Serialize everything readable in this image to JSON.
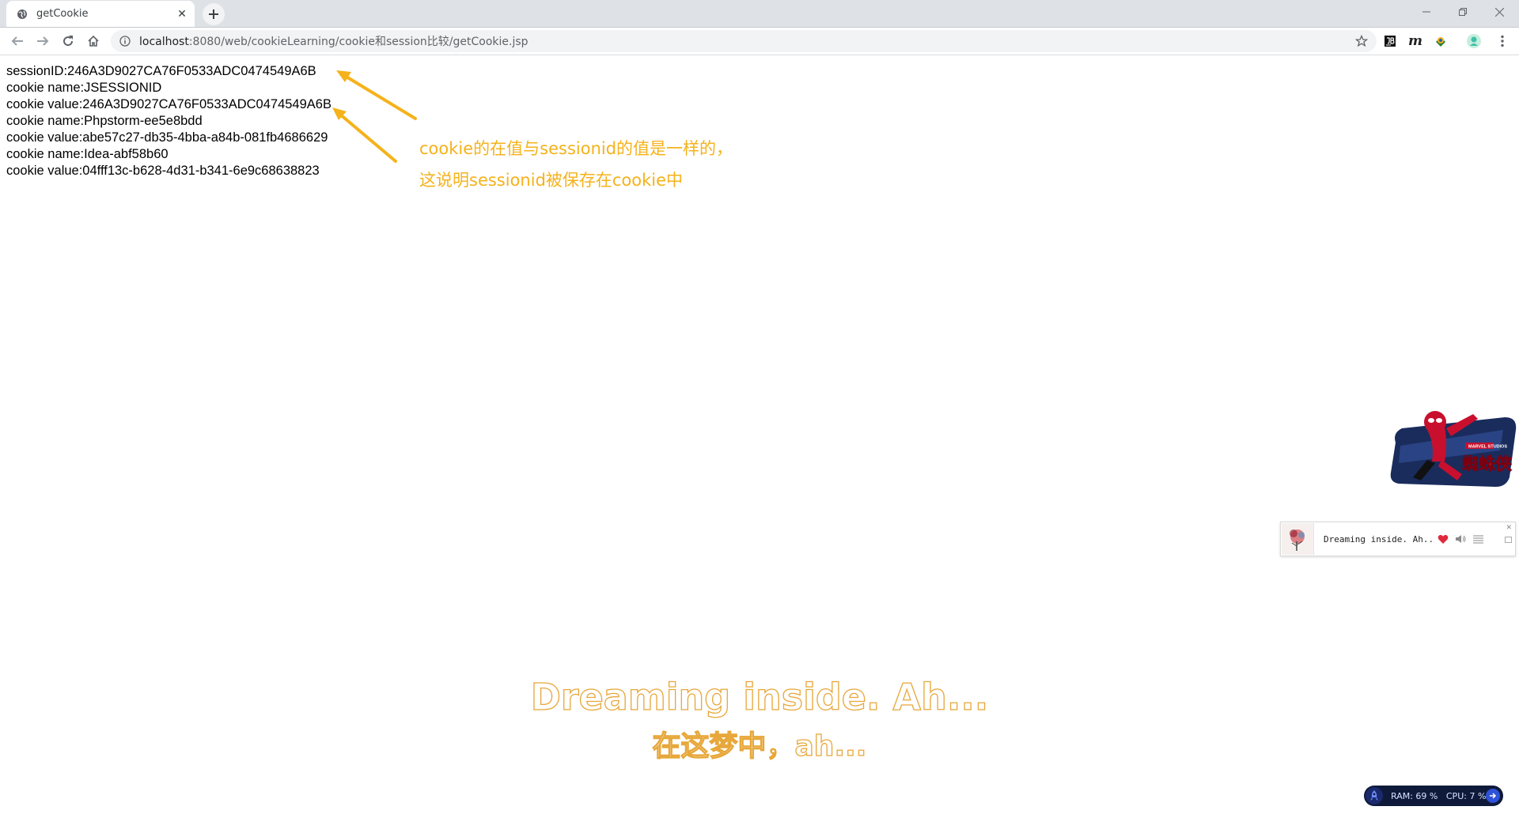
{
  "browser": {
    "tab": {
      "title": "getCookie"
    },
    "address": {
      "host": "localhost",
      "rest": ":8080/web/cookieLearning/cookie和session比较/getCookie.jsp"
    },
    "icons": [
      "globe-icon",
      "close-icon",
      "plus-icon",
      "minimize-icon",
      "restore-icon",
      "close-window-icon",
      "back-icon",
      "forward-icon",
      "reload-icon",
      "home-icon",
      "info-icon",
      "star-icon",
      "jb-extension-icon",
      "m-extension-icon",
      "extension-icon",
      "profile-icon",
      "menu-icon"
    ]
  },
  "page": {
    "lines": [
      "sessionID:246A3D9027CA76F0533ADC0474549A6B",
      "cookie name:JSESSIONID",
      "cookie value:246A3D9027CA76F0533ADC0474549A6B",
      "cookie name:Phpstorm-ee5e8bdd",
      "cookie value:abe57c27-db35-4bba-a84b-081fb4686629",
      "cookie name:Idea-abf58b60",
      "cookie value:04fff13c-b628-4d31-b341-6e9c68638823"
    ],
    "annotation": {
      "line1": "cookie的在值与sessionid的值是一样的，",
      "line2": "这说明sessionid被保存在cookie中",
      "color": "#f5b21b"
    }
  },
  "overlays": {
    "spiderman_logo": {
      "text": "蜘蛛侠",
      "small": "MARVEL STUDIOS"
    },
    "music_player": {
      "song": "Dreaming inside. Ah...",
      "heart_color": "#e02a3c"
    },
    "lyrics": {
      "line1": "Dreaming inside. Ah...",
      "line2": "在这梦中，ah..."
    },
    "monitor": {
      "ram": "RAM: 69 %",
      "cpu": "CPU: 7 %"
    }
  }
}
